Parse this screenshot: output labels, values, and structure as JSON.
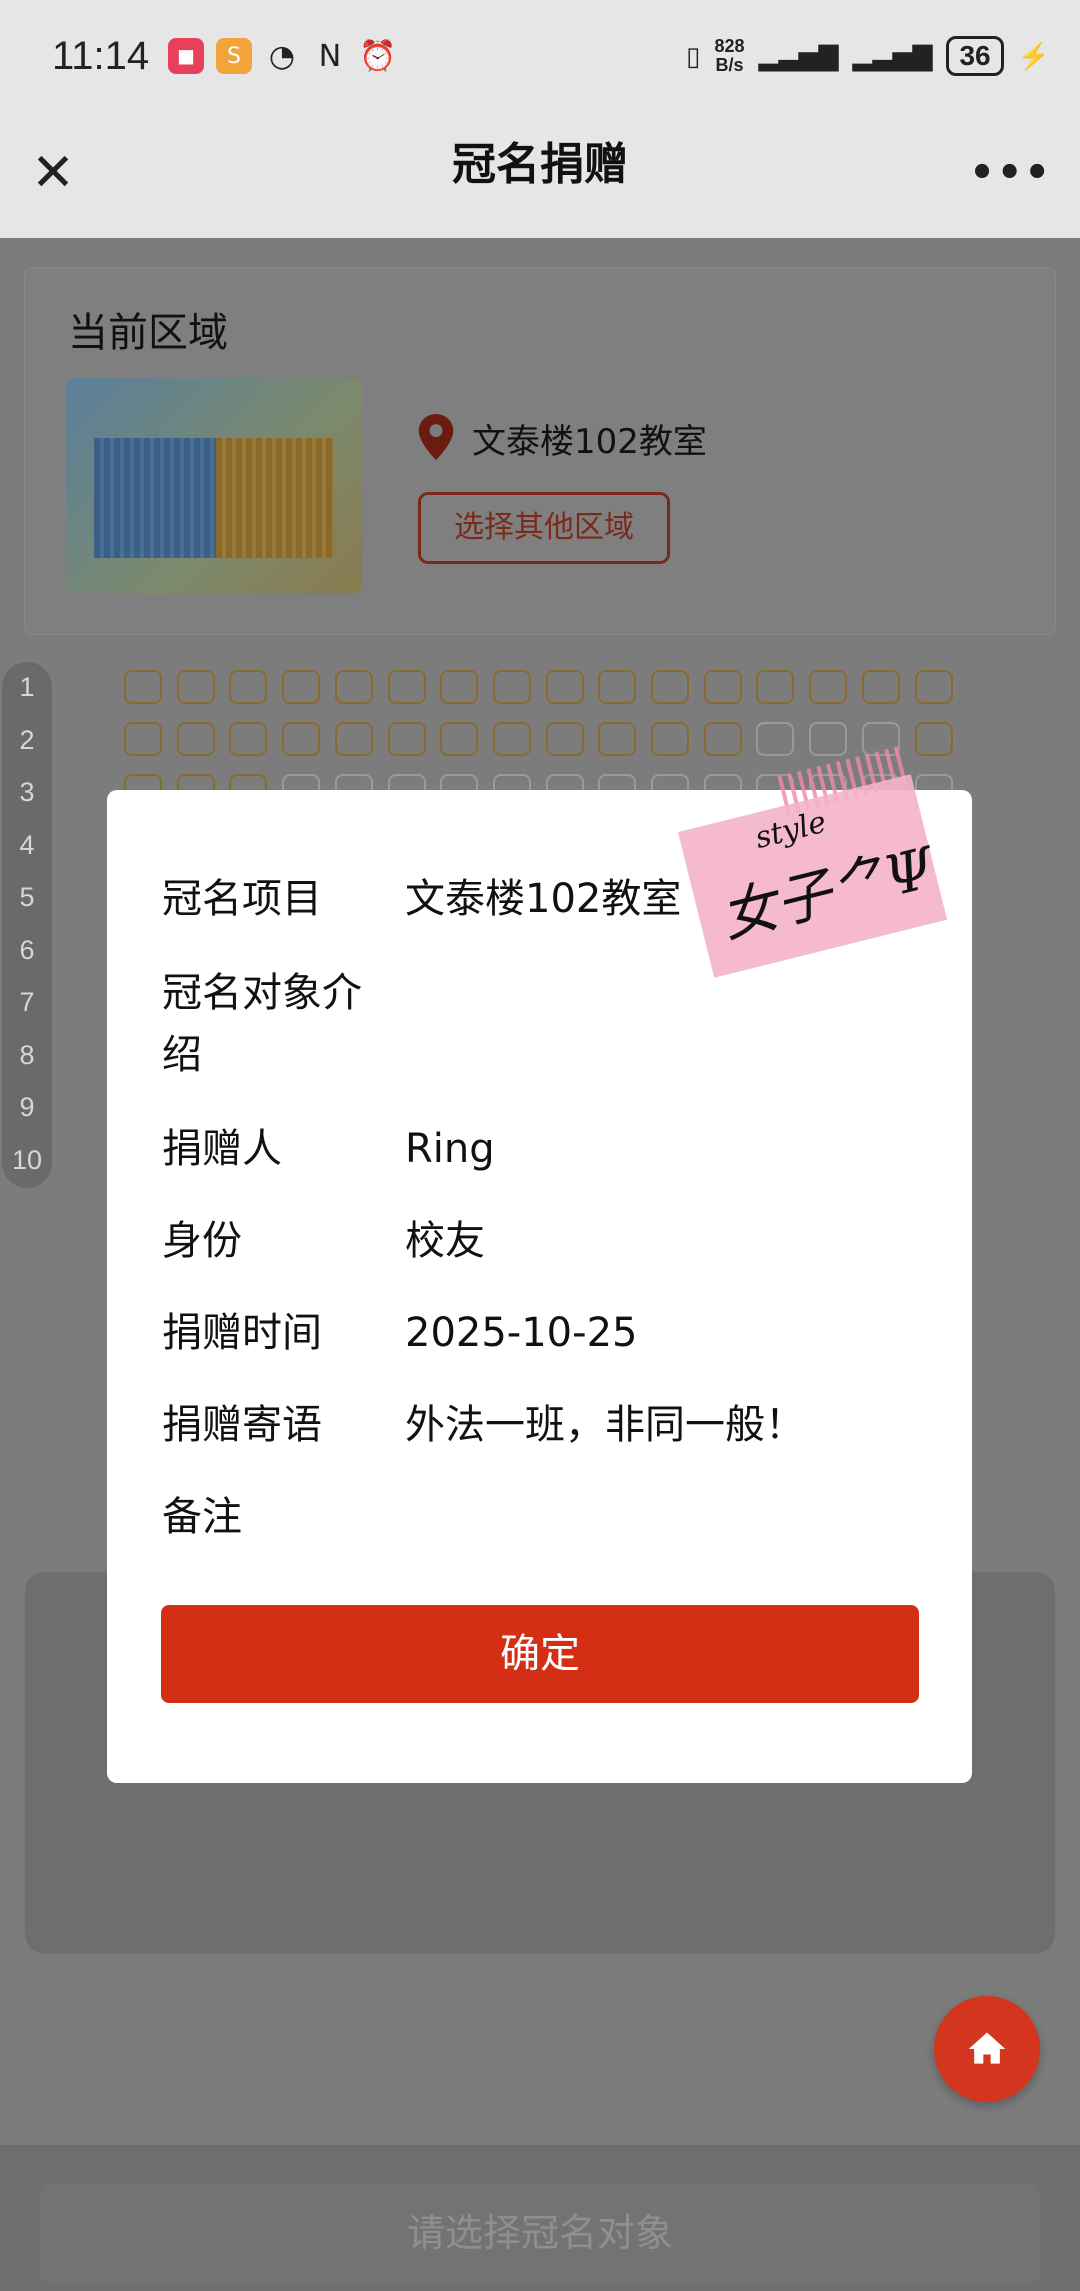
{
  "status_bar": {
    "time": "11:14",
    "net_speed_value": "828",
    "net_speed_unit": "B/s",
    "battery": "36"
  },
  "nav": {
    "title": "冠名捐赠",
    "close_icon": "close-icon",
    "more_icon": "more-icon"
  },
  "area": {
    "heading": "当前区域",
    "location": "文泰楼102教室",
    "change_button": "选择其他区域"
  },
  "rows": [
    "1",
    "2",
    "3",
    "4",
    "5",
    "6",
    "7",
    "8",
    "9",
    "10"
  ],
  "dialog": {
    "fields": [
      {
        "label": "冠名项目",
        "value": "文泰楼102教室"
      },
      {
        "label": "冠名对象介绍",
        "value": ""
      },
      {
        "label": "捐赠人",
        "value": "Ring"
      },
      {
        "label": "身份",
        "value": "校友"
      },
      {
        "label": "捐赠时间",
        "value": "2025-10-25"
      },
      {
        "label": "捐赠寄语",
        "value": "外法一班，非同一般！"
      },
      {
        "label": "备注",
        "value": ""
      }
    ],
    "confirm": "确定"
  },
  "sticker": {
    "small": "style",
    "main": "女子⺈Ψ"
  },
  "bottom": {
    "select_button": "请选择冠名对象"
  },
  "colors": {
    "accent": "#d42e14",
    "overlay": "#7c7c7c"
  }
}
